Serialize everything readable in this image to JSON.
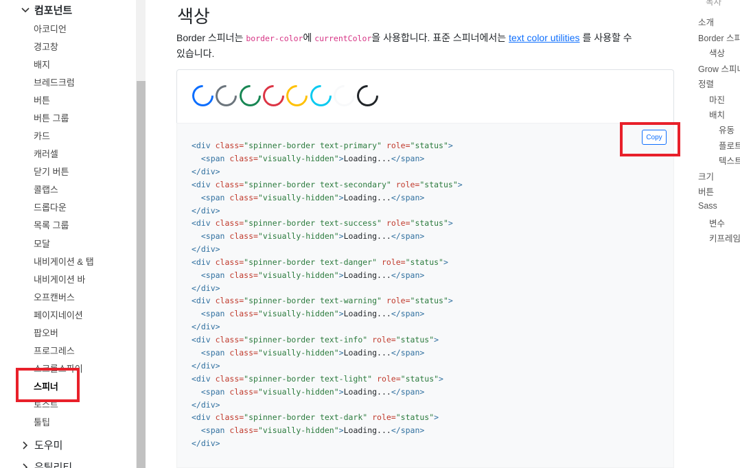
{
  "sidebar": {
    "group_components": "컴포넌트",
    "items": [
      "아코디언",
      "경고창",
      "배지",
      "브레드크럼",
      "버튼",
      "버튼 그룹",
      "카드",
      "캐러셀",
      "닫기 버튼",
      "콜랩스",
      "드롭다운",
      "목록 그룹",
      "모달",
      "내비게이션 & 탭",
      "내비게이션 바",
      "오프캔버스",
      "페이지네이션",
      "팝오버",
      "프로그레스",
      "스크롤스파이",
      "스피너",
      "토스트",
      "툴팁"
    ],
    "active_item": "스피너",
    "group_helpers": "도우미",
    "group_utilities": "유틸리티"
  },
  "main": {
    "title": "색상",
    "desc_prefix": "Border 스피너는 ",
    "code_border_color": "border-color",
    "desc_mid1": "에 ",
    "code_current_color": "currentColor",
    "desc_mid2": "을 사용합니다. 표준 스피너에서는 ",
    "link_text": "text color utilities",
    "desc_suffix1": " 를 사용할 수",
    "desc_suffix2": "있습니다.",
    "copy_label": "Copy"
  },
  "spinners": [
    {
      "variant": "primary",
      "color": "#0d6efd"
    },
    {
      "variant": "secondary",
      "color": "#6c757d"
    },
    {
      "variant": "success",
      "color": "#198754"
    },
    {
      "variant": "danger",
      "color": "#dc3545"
    },
    {
      "variant": "warning",
      "color": "#ffc107"
    },
    {
      "variant": "info",
      "color": "#0dcaf0"
    },
    {
      "variant": "light",
      "color": "#f8f9fa"
    },
    {
      "variant": "dark",
      "color": "#212529"
    }
  ],
  "code": {
    "open_tag": "<div",
    "class_attr": " class=",
    "role_attr": " role=",
    "role_val": "\"status\"",
    "gt": ">",
    "span_open": "<span",
    "span_class": "\"visually-hidden\"",
    "loading": "Loading...",
    "span_close": "</span>",
    "div_close": "</div>",
    "classes": [
      "\"spinner-border text-primary\"",
      "\"spinner-border text-secondary\"",
      "\"spinner-border text-success\"",
      "\"spinner-border text-danger\"",
      "\"spinner-border text-warning\"",
      "\"spinner-border text-info\"",
      "\"spinner-border text-light\"",
      "\"spinner-border text-dark\""
    ]
  },
  "toc": {
    "top": "목차",
    "items": [
      "소개",
      "Border 스피너",
      "색상",
      "Grow 스피너",
      "정렬",
      "마진",
      "배치",
      "유동",
      "플로트",
      "텍스트",
      "크기",
      "버튼",
      "Sass",
      "변수",
      "키프레임"
    ]
  },
  "colors": {
    "accent": "#0d6efd",
    "highlight": "#e8202a"
  }
}
